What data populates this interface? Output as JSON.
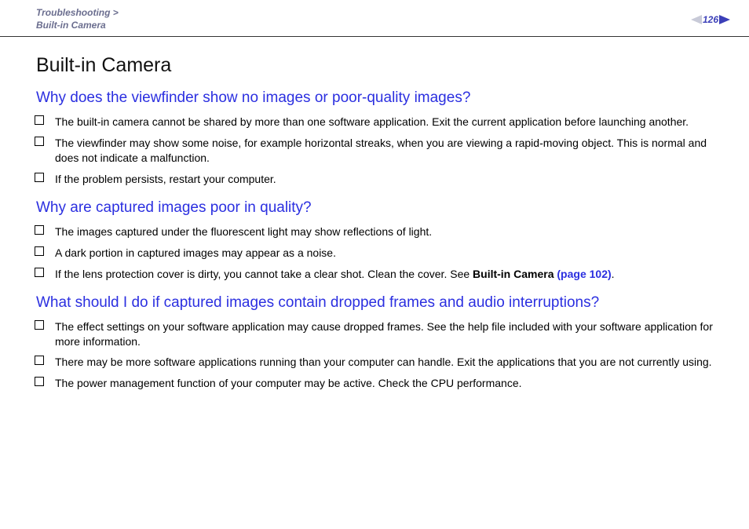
{
  "header": {
    "breadcrumb_section": "Troubleshooting",
    "breadcrumb_sep": " > ",
    "breadcrumb_page": "Built-in Camera",
    "page_number": "126"
  },
  "title": "Built-in Camera",
  "sections": [
    {
      "heading": "Why does the viewfinder show no images or poor-quality images?",
      "items": [
        {
          "text": "The built-in camera cannot be shared by more than one software application. Exit the current application before launching another."
        },
        {
          "text": "The viewfinder may show some noise, for example horizontal streaks, when you are viewing a rapid-moving object. This is normal and does not indicate a malfunction."
        },
        {
          "text": "If the problem persists, restart your computer."
        }
      ]
    },
    {
      "heading": "Why are captured images poor in quality?",
      "items": [
        {
          "text": "The images captured under the fluorescent light may show reflections of light."
        },
        {
          "text": "A dark portion in captured images may appear as a noise."
        },
        {
          "text_prefix": "If the lens protection cover is dirty, you cannot take a clear shot. Clean the cover. See ",
          "bold": "Built-in Camera",
          "link": " (page 102)",
          "suffix": "."
        }
      ]
    },
    {
      "heading": "What should I do if captured images contain dropped frames and audio interruptions?",
      "items": [
        {
          "text": "The effect settings on your software application may cause dropped frames. See the help file included with your software application for more information."
        },
        {
          "text": "There may be more software applications running than your computer can handle. Exit the applications that you are not currently using."
        },
        {
          "text": "The power management function of your computer may be active. Check the CPU performance."
        }
      ]
    }
  ]
}
